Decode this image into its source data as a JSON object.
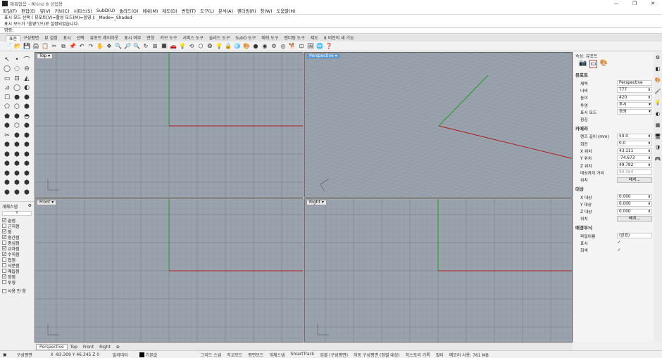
{
  "app": {
    "title": "제목없음 - Rhino 8 상업용",
    "win_buttons": [
      "—",
      "❐",
      "✕"
    ]
  },
  "menu": [
    "파일(F)",
    "편집(E)",
    "뷰(V)",
    "커브(C)",
    "서피스(S)",
    "SubD(U)",
    "솔리드(O)",
    "메쉬(M)",
    "제도(D)",
    "변형(T)",
    "도구(L)",
    "분석(A)",
    "렌더링(R)",
    "창(W)",
    "도움말(H)"
  ],
  "command": {
    "history": [
      "표시 모드 선택 ( 뷰포트(V)=활성 모드(M)=음영 ): _Mode=_Shaded",
      "표시 모드가 \"음영\"(으)로 설정되었습니다."
    ],
    "prompt": "명령:"
  },
  "tabs": [
    "표준",
    "구성평면",
    "뷰 설정",
    "표시",
    "선택",
    "뷰포트 레이아웃",
    "표시 여부",
    "변형",
    "커브 도구",
    "서피스 도구",
    "솔리드 도구",
    "SubD 도구",
    "메쉬 도구",
    "렌더링 도구",
    "제도",
    "8 버전의 새 기능"
  ],
  "toolbar_icons": [
    "📄",
    "📂",
    "💾",
    "🖨",
    "📋",
    "✂",
    "⧉",
    "📌",
    "↶",
    "↷",
    "✋",
    "✥",
    "🔍",
    "🔎",
    "🔍",
    "↻",
    "⊞",
    "🔳",
    "🚗",
    "💡",
    "⟲",
    "⬡",
    "❂",
    "💡",
    "🔒",
    "🧊",
    "🎨",
    "●",
    "◉",
    "⚙",
    "◎",
    "🐕",
    "⊡",
    "🖼",
    "🌐",
    "❓"
  ],
  "left_tools": [
    "↖",
    "•",
    "⌒",
    "◯",
    "◌",
    "⊖",
    "▭",
    "⊡",
    "◭",
    "⊿",
    "◯",
    "◐",
    "☐",
    "⬣",
    "⬢",
    "⬠",
    "⬡",
    "⬢",
    "⬟",
    "⬢",
    "◓",
    "⬢",
    "⬡",
    "⬢",
    "✂",
    "⬢",
    "⬢",
    "⬢",
    "⬢",
    "⬢",
    "⬢",
    "⬢",
    "⬢",
    "⬢",
    "⬢",
    "⬢",
    "⬢",
    "⬢",
    "⬢",
    "⬢",
    "⬢",
    "⬢",
    "⬢",
    "⬢",
    "⬢",
    "⬢",
    "⬢",
    "⬢",
    "⬢",
    "⬢",
    "⬢"
  ],
  "osnap": {
    "title": "개체스냅",
    "filter": "Y",
    "items": [
      {
        "label": "끝점",
        "checked": true
      },
      {
        "label": "근처점",
        "checked": false
      },
      {
        "label": "점",
        "checked": true
      },
      {
        "label": "중간점",
        "checked": true
      },
      {
        "label": "중심점",
        "checked": false
      },
      {
        "label": "교차점",
        "checked": true
      },
      {
        "label": "수직점",
        "checked": true
      },
      {
        "label": "접점",
        "checked": false
      },
      {
        "label": "사분점",
        "checked": false
      },
      {
        "label": "매듭점",
        "checked": false
      },
      {
        "label": "정점",
        "checked": true
      },
      {
        "label": "투영",
        "checked": false
      }
    ],
    "disable": "사용 안 함"
  },
  "viewports": {
    "top": "Top",
    "perspective": "Perspective",
    "front": "Front",
    "right": "Right"
  },
  "vp_tabs": [
    "Perspective",
    "Top",
    "Front",
    "Right",
    "⊕"
  ],
  "properties": {
    "title": "속성: 뷰포트",
    "viewport_section": "뷰포트",
    "rows": [
      {
        "k": "제목",
        "v": "Perspective",
        "kind": "text"
      },
      {
        "k": "너비",
        "v": "777",
        "kind": "spin"
      },
      {
        "k": "높이",
        "v": "420",
        "kind": "spin"
      },
      {
        "k": "투영",
        "v": "투시",
        "kind": "dd"
      },
      {
        "k": "표시 모드",
        "v": "음영",
        "kind": "dd"
      },
      {
        "k": "잠김",
        "v": "",
        "kind": "check"
      }
    ],
    "camera_section": "카메라",
    "camera_rows": [
      {
        "k": "렌즈 길이 (mm)",
        "v": "50.0",
        "kind": "spin"
      },
      {
        "k": "회전",
        "v": "0.0",
        "kind": "spin"
      },
      {
        "k": "X 위치",
        "v": "43.111",
        "kind": "spin"
      },
      {
        "k": "Y 위치",
        "v": "-74.673",
        "kind": "spin"
      },
      {
        "k": "Z 위치",
        "v": "49.782",
        "kind": "spin"
      },
      {
        "k": "대상까지 거리",
        "v": "99.564",
        "kind": "grey"
      },
      {
        "k": "위치",
        "v": "배치...",
        "kind": "btn"
      }
    ],
    "target_section": "대상",
    "target_rows": [
      {
        "k": "X 대상",
        "v": "0.000",
        "kind": "spin"
      },
      {
        "k": "Y 대상",
        "v": "0.000",
        "kind": "spin"
      },
      {
        "k": "Z 대상",
        "v": "0.000",
        "kind": "spin"
      },
      {
        "k": "위치",
        "v": "배치...",
        "kind": "btn"
      }
    ],
    "bg_section": "배경무늬",
    "bg_rows": [
      {
        "k": "파일이름",
        "v": "(없음)",
        "kind": "text"
      },
      {
        "k": "표시",
        "v": "✓",
        "kind": "check"
      },
      {
        "k": "회색",
        "v": "✓",
        "kind": "check"
      }
    ]
  },
  "status": {
    "cplane": "구성평면",
    "coords": "X -83.309 Y 46.345 Z 0",
    "units": "밀리미터",
    "layer": "기본값",
    "items": [
      "그리드 스냅",
      "직교모드",
      "평면모드",
      "개체스냅",
      "SmartTrack",
      "검볼 (구성평면)",
      "자동 구성평면 (정렬 대상)",
      "히스토리 기록",
      "필터",
      "메모리 사용: 761 MB"
    ]
  }
}
